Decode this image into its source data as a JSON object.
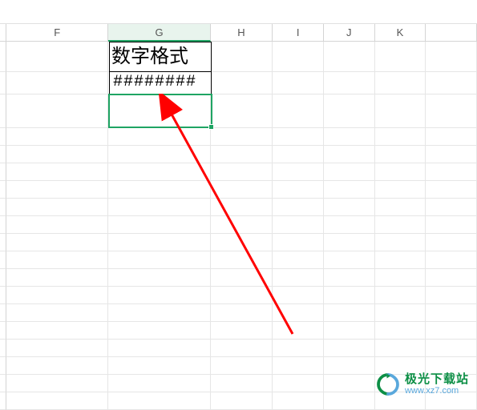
{
  "columns": {
    "F": "F",
    "G": "G",
    "H": "H",
    "I": "I",
    "J": "J",
    "K": "K"
  },
  "cells": {
    "G1": "数字格式",
    "G2": "########"
  },
  "selected_cell_ref": "G3",
  "watermark": {
    "title": "极光下载站",
    "url": "www.xz7.com"
  }
}
